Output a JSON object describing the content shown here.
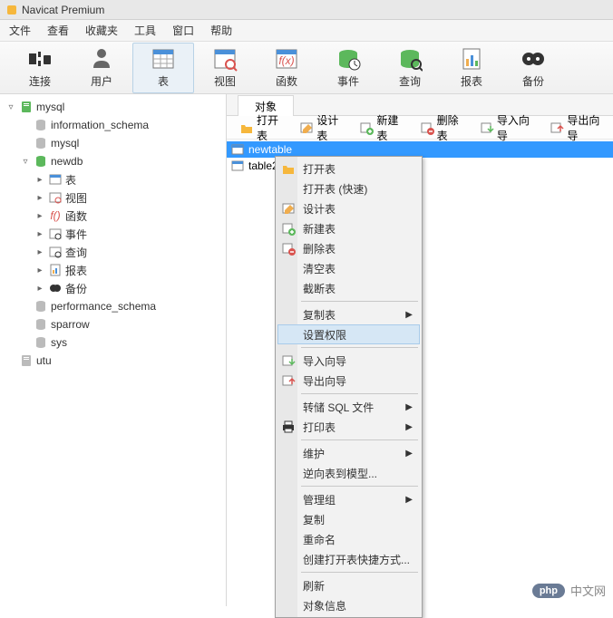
{
  "title": "Navicat Premium",
  "menubar": [
    "文件",
    "查看",
    "收藏夹",
    "工具",
    "窗口",
    "帮助"
  ],
  "toolbar": [
    {
      "label": "连接",
      "icon": "plug"
    },
    {
      "label": "用户",
      "icon": "user"
    },
    {
      "label": "表",
      "icon": "table",
      "active": true
    },
    {
      "label": "视图",
      "icon": "view"
    },
    {
      "label": "函数",
      "icon": "fx"
    },
    {
      "label": "事件",
      "icon": "event"
    },
    {
      "label": "查询",
      "icon": "query"
    },
    {
      "label": "报表",
      "icon": "report"
    },
    {
      "label": "备份",
      "icon": "backup"
    }
  ],
  "tree": [
    {
      "label": "mysql",
      "icon": "server",
      "exp": "▿",
      "indent": 0
    },
    {
      "label": "information_schema",
      "icon": "db",
      "exp": "",
      "indent": 1
    },
    {
      "label": "mysql",
      "icon": "db",
      "exp": "",
      "indent": 1
    },
    {
      "label": "newdb",
      "icon": "db-open",
      "exp": "▿",
      "indent": 1
    },
    {
      "label": "表",
      "icon": "table-s",
      "exp": "▸",
      "indent": 2
    },
    {
      "label": "视图",
      "icon": "view-s",
      "exp": "▸",
      "indent": 2
    },
    {
      "label": "函数",
      "icon": "fx-s",
      "exp": "▸",
      "indent": 2
    },
    {
      "label": "事件",
      "icon": "event-s",
      "exp": "▸",
      "indent": 2
    },
    {
      "label": "查询",
      "icon": "query-s",
      "exp": "▸",
      "indent": 2
    },
    {
      "label": "报表",
      "icon": "report-s",
      "exp": "▸",
      "indent": 2
    },
    {
      "label": "备份",
      "icon": "backup-s",
      "exp": "▸",
      "indent": 2
    },
    {
      "label": "performance_schema",
      "icon": "db",
      "exp": "",
      "indent": 1
    },
    {
      "label": "sparrow",
      "icon": "db",
      "exp": "",
      "indent": 1
    },
    {
      "label": "sys",
      "icon": "db",
      "exp": "",
      "indent": 1
    },
    {
      "label": "utu",
      "icon": "server-off",
      "exp": "",
      "indent": 0
    }
  ],
  "tab": "对象",
  "actions": [
    {
      "label": "打开表",
      "icon": "open"
    },
    {
      "label": "设计表",
      "icon": "design"
    },
    {
      "label": "新建表",
      "icon": "new"
    },
    {
      "label": "删除表",
      "icon": "delete"
    },
    {
      "label": "导入向导",
      "icon": "import"
    },
    {
      "label": "导出向导",
      "icon": "export"
    }
  ],
  "tables": [
    {
      "name": "newtable",
      "selected": true
    },
    {
      "name": "table2",
      "selected": false
    }
  ],
  "contextMenu": [
    {
      "type": "item",
      "label": "打开表",
      "icon": "open"
    },
    {
      "type": "item",
      "label": "打开表 (快速)",
      "icon": ""
    },
    {
      "type": "item",
      "label": "设计表",
      "icon": "design"
    },
    {
      "type": "item",
      "label": "新建表",
      "icon": "new"
    },
    {
      "type": "item",
      "label": "删除表",
      "icon": "delete"
    },
    {
      "type": "item",
      "label": "清空表",
      "icon": ""
    },
    {
      "type": "item",
      "label": "截断表",
      "icon": ""
    },
    {
      "type": "sep"
    },
    {
      "type": "item",
      "label": "复制表",
      "icon": "",
      "sub": true
    },
    {
      "type": "item",
      "label": "设置权限",
      "icon": "",
      "highlighted": true
    },
    {
      "type": "sep"
    },
    {
      "type": "item",
      "label": "导入向导",
      "icon": "import"
    },
    {
      "type": "item",
      "label": "导出向导",
      "icon": "export"
    },
    {
      "type": "sep"
    },
    {
      "type": "item",
      "label": "转储 SQL 文件",
      "icon": "",
      "sub": true
    },
    {
      "type": "item",
      "label": "打印表",
      "icon": "print",
      "sub": true
    },
    {
      "type": "sep"
    },
    {
      "type": "item",
      "label": "维护",
      "icon": "",
      "sub": true
    },
    {
      "type": "item",
      "label": "逆向表到模型...",
      "icon": ""
    },
    {
      "type": "sep"
    },
    {
      "type": "item",
      "label": "管理组",
      "icon": "",
      "sub": true
    },
    {
      "type": "item",
      "label": "复制",
      "icon": ""
    },
    {
      "type": "item",
      "label": "重命名",
      "icon": ""
    },
    {
      "type": "item",
      "label": "创建打开表快捷方式...",
      "icon": ""
    },
    {
      "type": "sep"
    },
    {
      "type": "item",
      "label": "刷新",
      "icon": ""
    },
    {
      "type": "item",
      "label": "对象信息",
      "icon": ""
    }
  ],
  "watermark": {
    "logo": "php",
    "text": "中文网"
  }
}
